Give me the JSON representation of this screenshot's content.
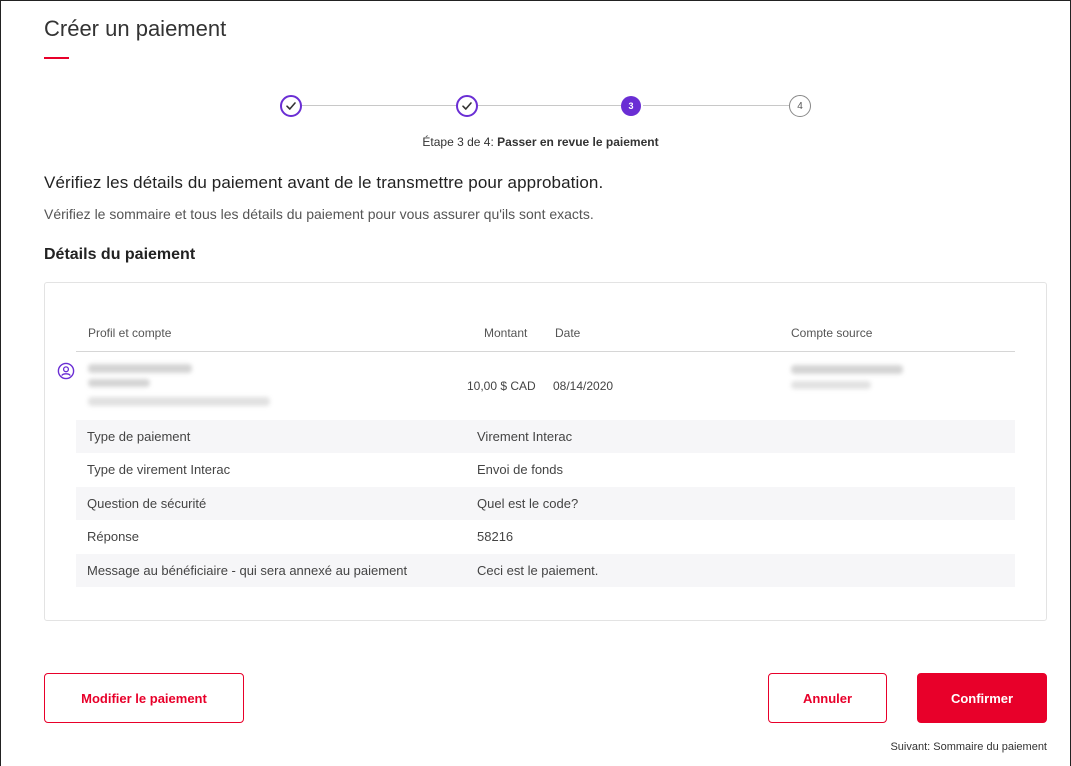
{
  "page": {
    "title": "Créer un paiement"
  },
  "stepper": {
    "steps": [
      {
        "status": "done",
        "label": ""
      },
      {
        "status": "done",
        "label": ""
      },
      {
        "status": "active",
        "label": "3"
      },
      {
        "status": "pending",
        "label": "4"
      }
    ],
    "caption_prefix": "Étape 3 de 4: ",
    "caption_bold": "Passer en revue le paiement"
  },
  "review": {
    "heading": "Vérifiez les détails du paiement avant de le transmettre pour approbation.",
    "subtext": "Vérifiez le sommaire et tous les détails du paiement pour vous assurer qu'ils sont exacts.",
    "section_title": "Détails du paiement"
  },
  "table": {
    "headers": {
      "profile": "Profil et compte",
      "amount": "Montant",
      "date": "Date",
      "source": "Compte source"
    },
    "row": {
      "amount": "10,00 $ CAD",
      "date": "08/14/2020"
    }
  },
  "details": [
    {
      "label": "Type de paiement",
      "value": "Virement Interac"
    },
    {
      "label": "Type de virement Interac",
      "value": "Envoi de fonds"
    },
    {
      "label": "Question de sécurité",
      "value": "Quel est le code?"
    },
    {
      "label": "Réponse",
      "value": "58216"
    },
    {
      "label": "Message au bénéficiaire - qui sera annexé au paiement",
      "value": "Ceci est le paiement."
    }
  ],
  "actions": {
    "modify_label": "Modifier le paiement",
    "cancel_label": "Annuler",
    "confirm_label": "Confirmer",
    "next_hint": "Suivant: Sommaire du paiement"
  },
  "colors": {
    "brand_red": "#e8002a",
    "step_purple": "#6a2ed4"
  },
  "icons": {
    "step_done": "check-circle-icon",
    "profile": "person-icon"
  }
}
